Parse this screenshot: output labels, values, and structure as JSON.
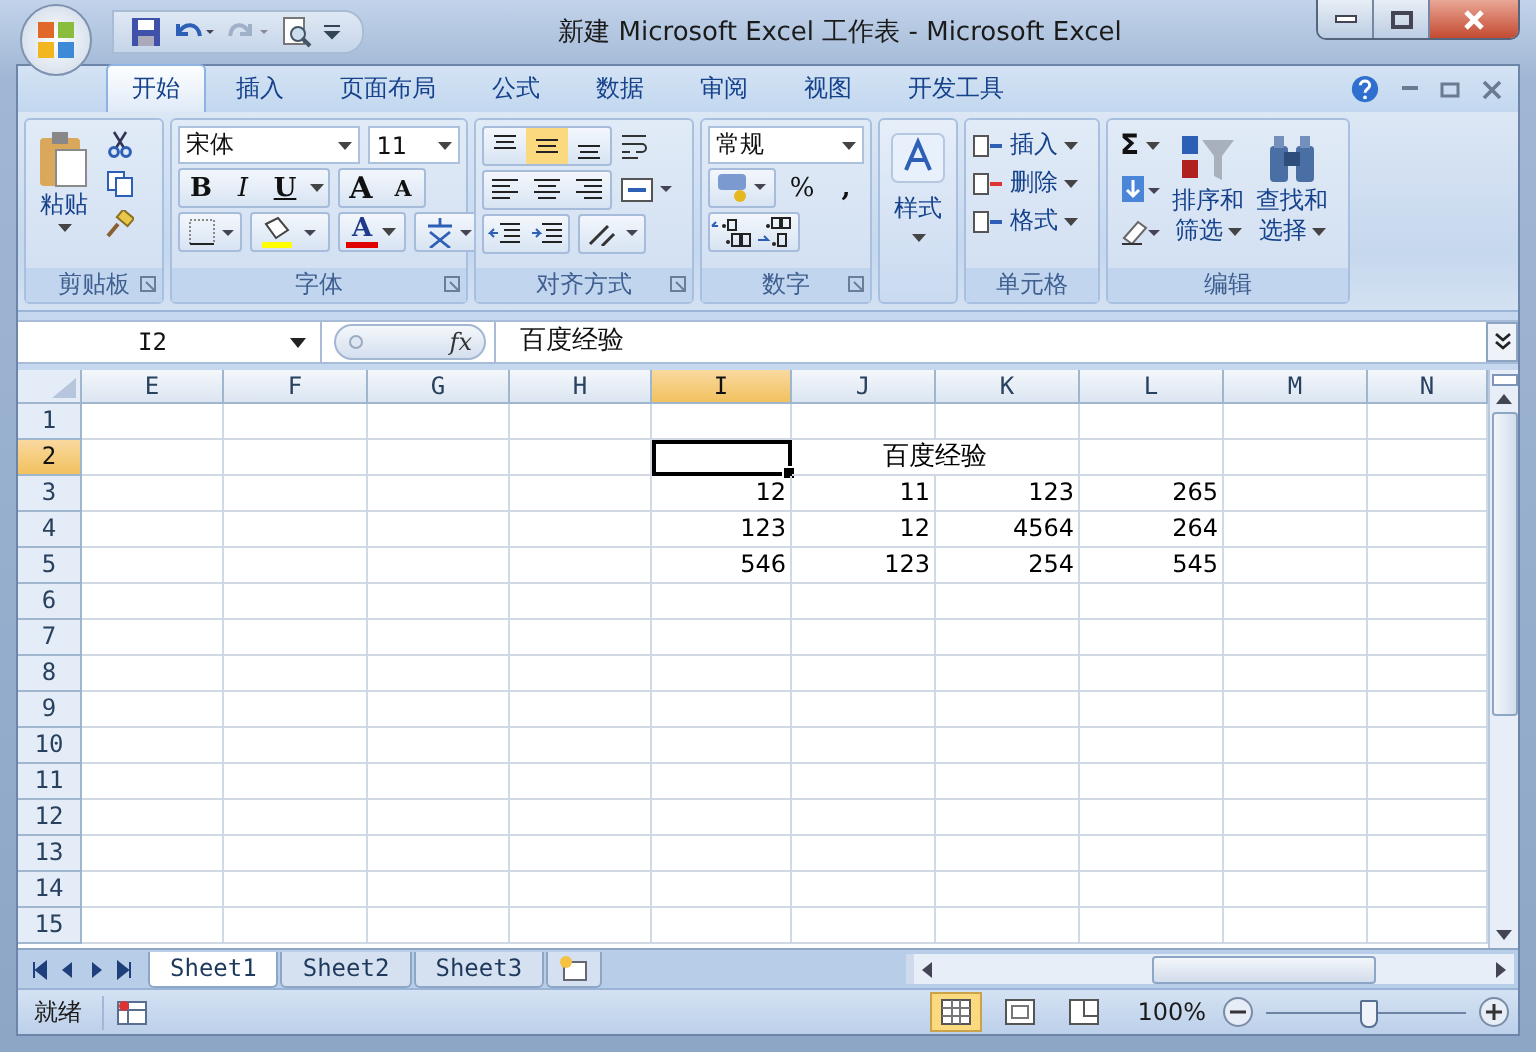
{
  "title": "新建 Microsoft Excel 工作表 - Microsoft Excel",
  "tabs": [
    {
      "label": "开始",
      "selected": true
    },
    {
      "label": "插入",
      "selected": false
    },
    {
      "label": "页面布局",
      "selected": false
    },
    {
      "label": "公式",
      "selected": false
    },
    {
      "label": "数据",
      "selected": false
    },
    {
      "label": "审阅",
      "selected": false
    },
    {
      "label": "视图",
      "selected": false
    },
    {
      "label": "开发工具",
      "selected": false
    }
  ],
  "ribbon": {
    "clipboard": {
      "paste": "粘贴",
      "label": "剪贴板"
    },
    "font": {
      "font_name": "宋体",
      "font_size": "11",
      "bold": "B",
      "italic": "I",
      "underline": "U",
      "grow": "A",
      "shrink": "A",
      "font_color": "A",
      "label": "字体"
    },
    "alignment": {
      "label": "对齐方式"
    },
    "number": {
      "format": "常规",
      "percent": "%",
      "comma": ",",
      "label": "数字"
    },
    "styles": {
      "label": "样式"
    },
    "cells": {
      "items": [
        "插入",
        "删除",
        "格式"
      ],
      "label": "单元格"
    },
    "editing": {
      "sum": "Σ",
      "sort": [
        "排序和",
        "筛选"
      ],
      "find": [
        "查找和",
        "选择"
      ],
      "label": "编辑"
    }
  },
  "formula_bar": {
    "name_box": "I2",
    "fx": "fx",
    "value": "百度经验"
  },
  "columns": [
    {
      "label": "E",
      "selected": false
    },
    {
      "label": "F",
      "selected": false
    },
    {
      "label": "G",
      "selected": false
    },
    {
      "label": "H",
      "selected": false
    },
    {
      "label": "I",
      "selected": true
    },
    {
      "label": "J",
      "selected": false
    },
    {
      "label": "K",
      "selected": false
    },
    {
      "label": "L",
      "selected": false
    },
    {
      "label": "M",
      "selected": false
    },
    {
      "label": "N",
      "selected": false
    }
  ],
  "rows": [
    {
      "label": "1",
      "selected": false,
      "cells": []
    },
    {
      "label": "2",
      "selected": true,
      "cells": [
        null,
        null,
        null,
        null,
        null,
        {
          "value": "百度经验",
          "kind": "merged"
        }
      ]
    },
    {
      "label": "3",
      "selected": false,
      "cells": [
        null,
        null,
        null,
        null,
        {
          "value": "12",
          "kind": "number"
        },
        {
          "value": "11",
          "kind": "number"
        },
        {
          "value": "123",
          "kind": "number"
        },
        {
          "value": "265",
          "kind": "number"
        }
      ]
    },
    {
      "label": "4",
      "selected": false,
      "cells": [
        null,
        null,
        null,
        null,
        {
          "value": "123",
          "kind": "number"
        },
        {
          "value": "12",
          "kind": "number"
        },
        {
          "value": "4564",
          "kind": "number"
        },
        {
          "value": "264",
          "kind": "number"
        }
      ]
    },
    {
      "label": "5",
      "selected": false,
      "cells": [
        null,
        null,
        null,
        null,
        {
          "value": "546",
          "kind": "number"
        },
        {
          "value": "123",
          "kind": "number"
        },
        {
          "value": "254",
          "kind": "number"
        },
        {
          "value": "545",
          "kind": "number"
        }
      ]
    },
    {
      "label": "6",
      "selected": false,
      "cells": []
    },
    {
      "label": "7",
      "selected": false,
      "cells": []
    },
    {
      "label": "8",
      "selected": false,
      "cells": []
    },
    {
      "label": "9",
      "selected": false,
      "cells": []
    },
    {
      "label": "10",
      "selected": false,
      "cells": []
    },
    {
      "label": "11",
      "selected": false,
      "cells": []
    },
    {
      "label": "12",
      "selected": false,
      "cells": []
    },
    {
      "label": "13",
      "selected": false,
      "cells": []
    },
    {
      "label": "14",
      "selected": false,
      "cells": []
    },
    {
      "label": "15",
      "selected": false,
      "cells": []
    }
  ],
  "sheets": [
    {
      "label": "Sheet1",
      "selected": true
    },
    {
      "label": "Sheet2",
      "selected": false
    },
    {
      "label": "Sheet3",
      "selected": false
    }
  ],
  "status_bar": {
    "status": "就绪",
    "zoom": "100%",
    "zoom_slider": {
      "level": 0.5
    }
  }
}
